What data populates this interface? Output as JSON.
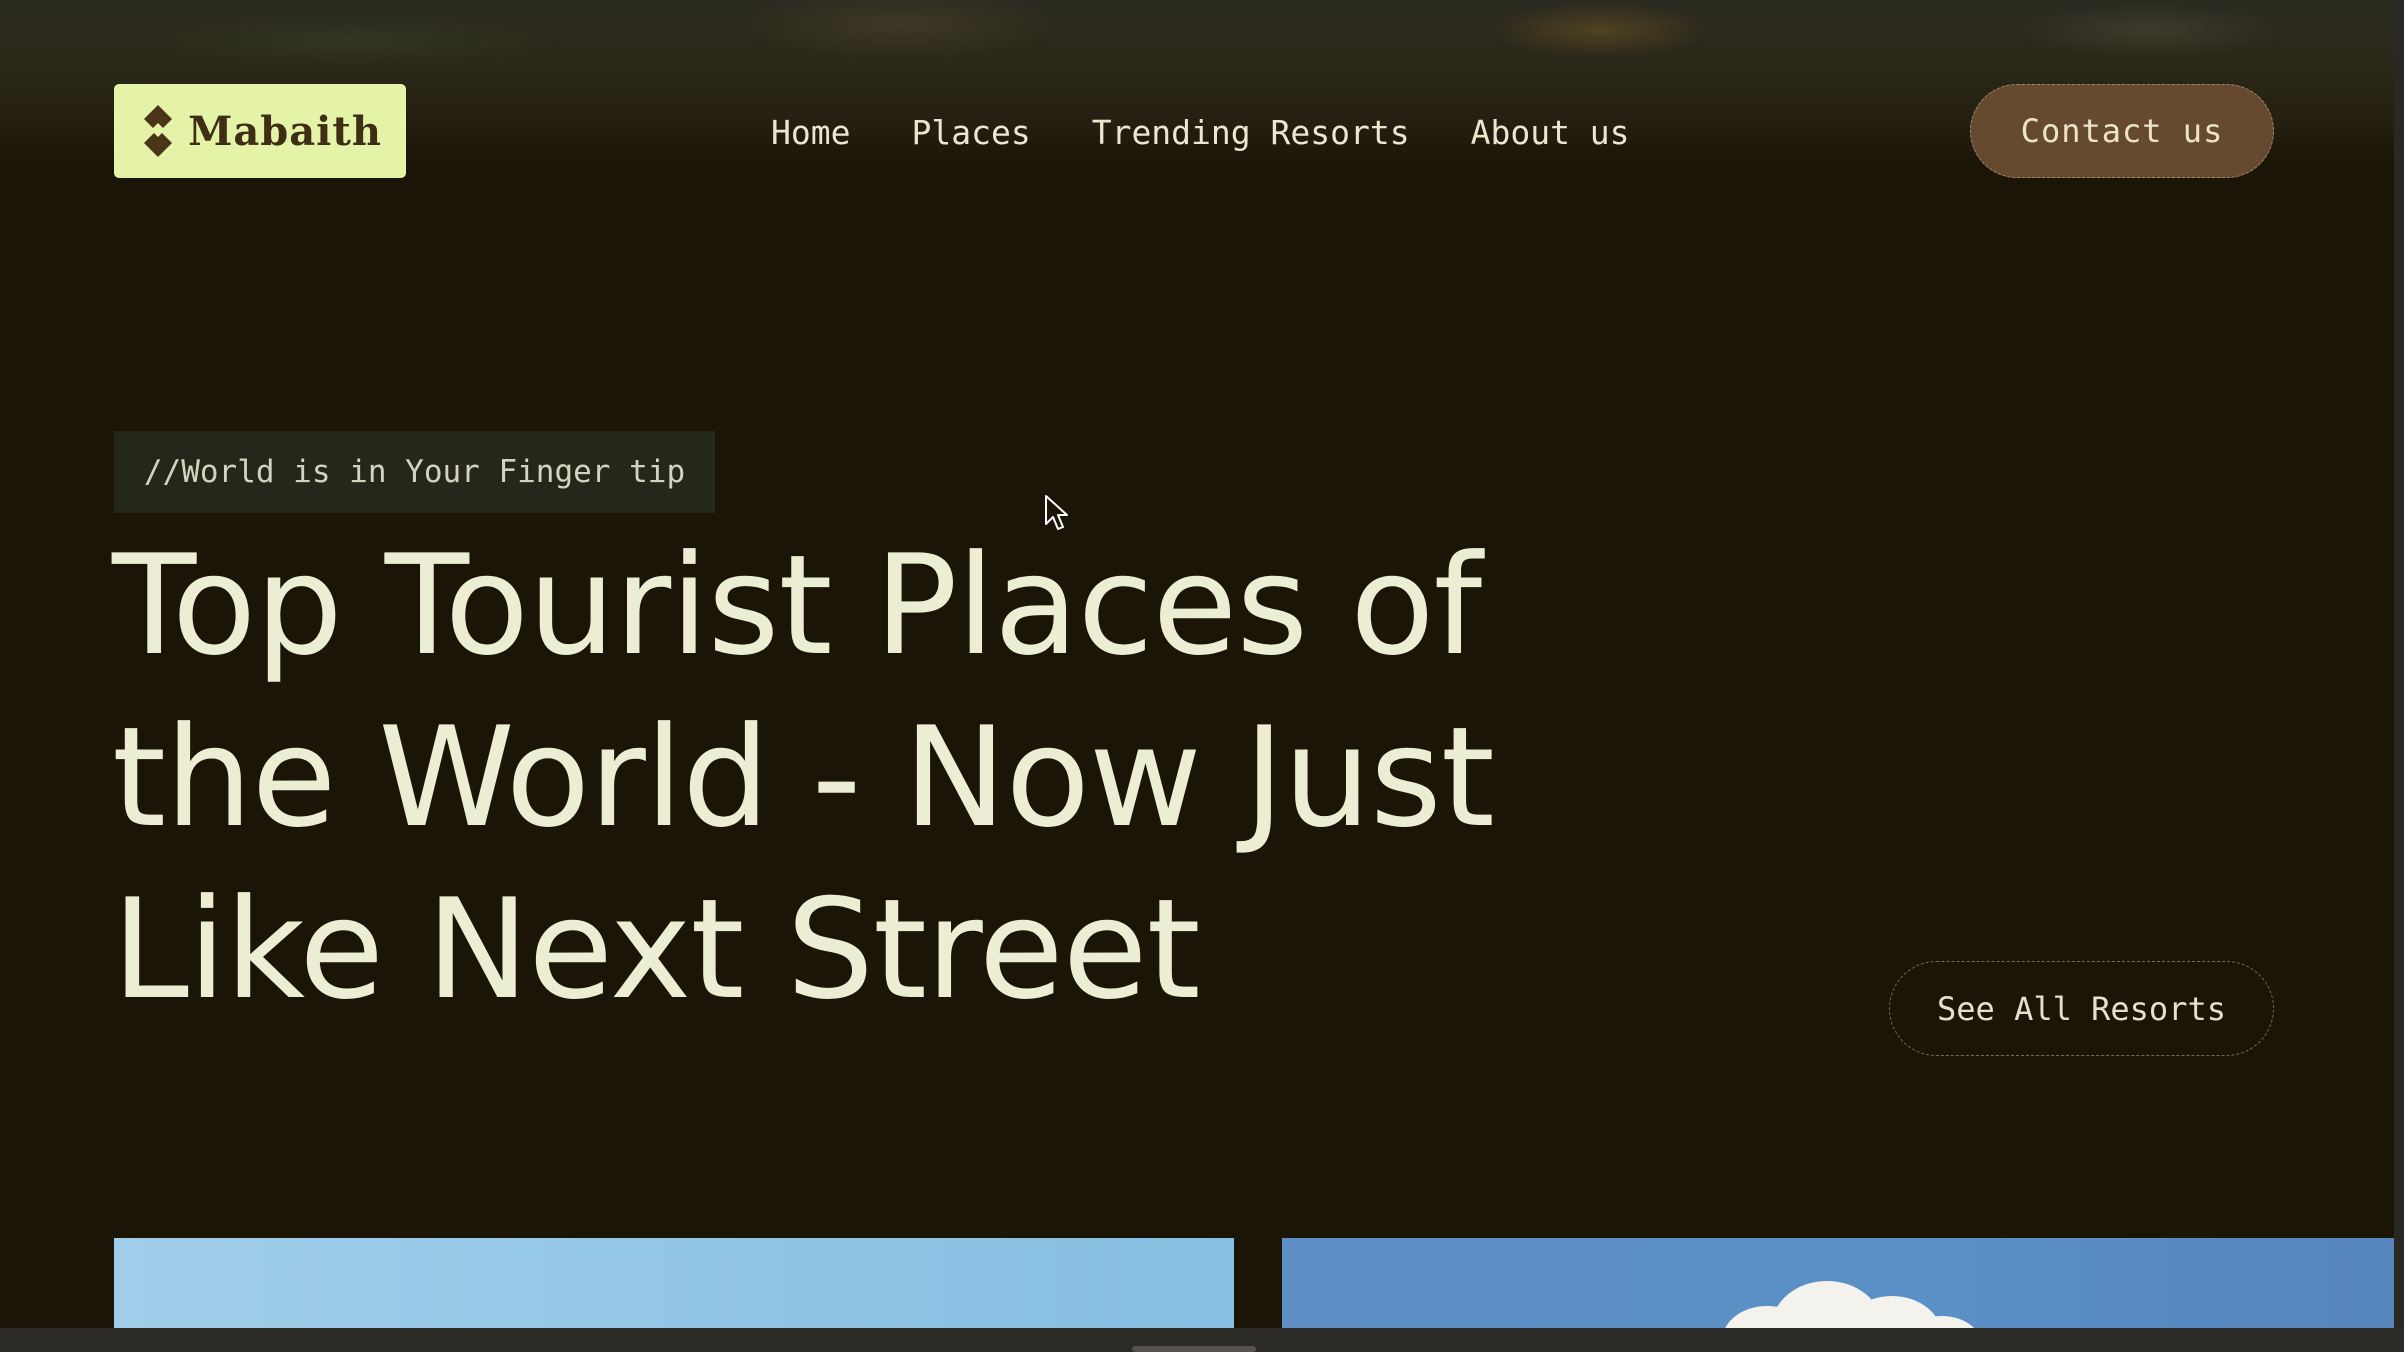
{
  "brand": {
    "name": "Mabaith",
    "logo_icon": "diamond-logo-icon"
  },
  "nav": {
    "items": [
      {
        "label": "Home"
      },
      {
        "label": "Places"
      },
      {
        "label": "Trending Resorts"
      },
      {
        "label": "About us"
      }
    ],
    "contact_label": "Contact us"
  },
  "hero": {
    "tagline": "//World is in Your Finger tip",
    "headline_lines": [
      "Top Tourist Places of",
      "the World - Now Just",
      "Like Next Street"
    ],
    "see_all_label": "See All Resorts"
  },
  "colors": {
    "background": "#1a1507",
    "logo_bg": "#e5f3a8",
    "contact_bg": "#654a2f",
    "headline": "#ebeed3",
    "tagline_bg": "#24271a"
  },
  "icons": [
    "diamond-logo-icon",
    "mouse-cursor-icon"
  ]
}
